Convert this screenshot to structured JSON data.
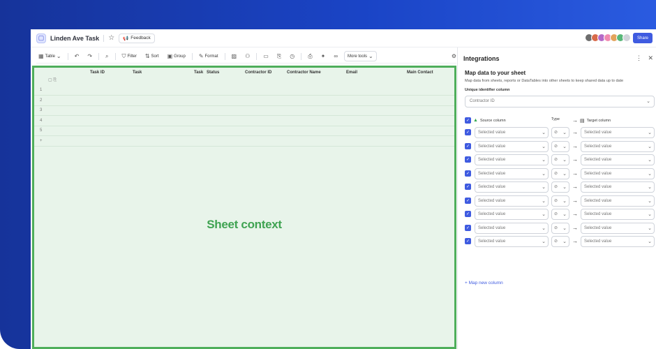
{
  "header": {
    "doc_title": "Linden Ave Task",
    "feedback_label": "Feedback",
    "share_label": "Share",
    "avatars": [
      "#6d6d6d",
      "#d86a4a",
      "#b46ac8",
      "#f08ab0",
      "#e3a35c",
      "#58b778",
      "#d0d3d9"
    ]
  },
  "toolbar": {
    "table_label": "Table",
    "filter_label": "Filter",
    "sort_label": "Sort",
    "group_label": "Group",
    "format_label": "Format",
    "more_tools_label": "More tools"
  },
  "sheet": {
    "columns": [
      "Task ID",
      "Task",
      "Task",
      "Status",
      "Contractor ID",
      "Contractor Name",
      "Email",
      "Main Contact"
    ],
    "row_numbers": [
      "1",
      "2",
      "3",
      "4",
      "5"
    ],
    "add_row": "+",
    "overlay_label": "Sheet context"
  },
  "panel": {
    "title": "Integrations",
    "map_title": "Map data to your sheet",
    "map_desc": "Map data from sheets, reports or DataTables into other sheets to keep shared data up to date",
    "uid_label": "Unique identifier column",
    "uid_value": "Contractor ID",
    "source_header": "Source column",
    "type_header": "Type",
    "target_header": "Target column",
    "rows": [
      {
        "source": "Selected value",
        "target": "Selected value"
      },
      {
        "source": "Selected value",
        "target": "Selected value"
      },
      {
        "source": "Selected value",
        "target": "Selected value"
      },
      {
        "source": "Selected value",
        "target": "Selected value"
      },
      {
        "source": "Selected value",
        "target": "Selected value"
      },
      {
        "source": "Selected value",
        "target": "Selected value"
      },
      {
        "source": "Selected value",
        "target": "Selected value"
      },
      {
        "source": "Selected value",
        "target": "Selected value"
      },
      {
        "source": "Selected value",
        "target": "Selected value"
      }
    ],
    "add_column_label": "Map new column"
  },
  "colors": {
    "accent": "#3f5be0",
    "sheet_bg": "#e8f4ea",
    "sheet_border": "#4eae5b",
    "background_gradient_start": "#16339a",
    "background_gradient_end": "#2a5be0"
  }
}
